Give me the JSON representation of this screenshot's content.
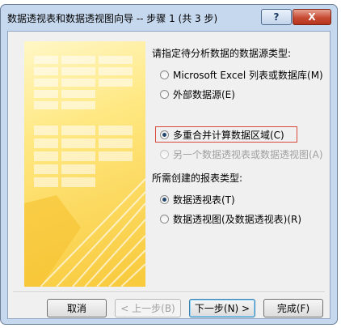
{
  "window": {
    "title": "数据透视表和数据透视图向导 -- 步骤 1 (共 3 步)",
    "help_label": "?",
    "close_label": "X"
  },
  "source_group": {
    "label": "请指定待分析数据的数据源类型:",
    "options": [
      {
        "label": "Microsoft Excel 列表或数据库(M)",
        "checked": false,
        "enabled": true
      },
      {
        "label": "外部数据源(E)",
        "checked": false,
        "enabled": true
      },
      {
        "label": "多重合并计算数据区域(C)",
        "checked": true,
        "enabled": true
      },
      {
        "label": "另一个数据透视表或数据透视图(A)",
        "checked": false,
        "enabled": false
      }
    ]
  },
  "report_group": {
    "label": "所需创建的报表类型:",
    "options": [
      {
        "label": "数据透视表(T)",
        "checked": true
      },
      {
        "label": "数据透视图(及数据透视表)(R)",
        "checked": false
      }
    ]
  },
  "buttons": {
    "cancel": "取消",
    "back": "< 上一步(B)",
    "next": "下一步(N) >",
    "finish": "完成(F)"
  }
}
